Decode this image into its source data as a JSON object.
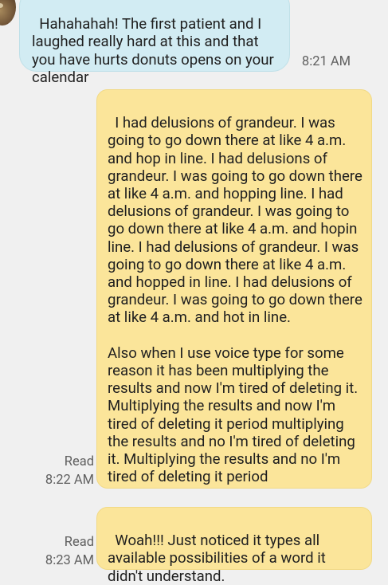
{
  "conversation": {
    "incoming": {
      "text": "Hahahahah! The first patient and I laughed really hard at this and that you have hurts donuts opens on your calendar",
      "time": "8:21 AM"
    },
    "outgoing": [
      {
        "text": "I had delusions of grandeur. I was going to go down there at like 4 a.m. and hop in line. I had delusions of grandeur. I was going to go down there at like 4 a.m. and hopping line. I had delusions of grandeur. I was going to go down there at like 4 a.m. and hopin line. I had delusions of grandeur. I was going to go down there at like 4 a.m. and hopped in line. I had delusions of grandeur. I was going to go down there at like 4 a.m. and hot in line.\n\nAlso when I use voice type for some reason it has been multiplying the results and now I'm tired of deleting it. Multiplying the results and now I'm tired of deleting it period multiplying the results and no I'm tired of deleting it. Multiplying the results and no I'm tired of deleting it period",
        "status": "Read",
        "time": "8:22 AM"
      },
      {
        "text": "Woah!!! Just noticed it types all available possibilities of a word it didn't understand.",
        "status": "Read",
        "time": "8:23 AM"
      }
    ]
  }
}
